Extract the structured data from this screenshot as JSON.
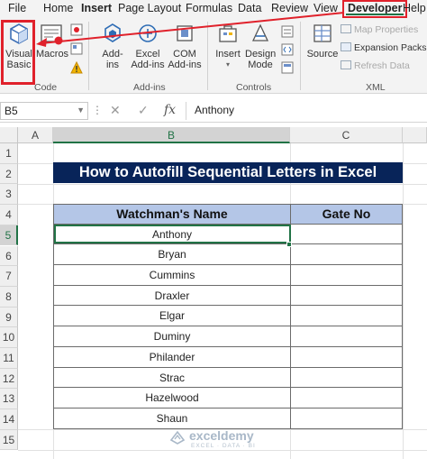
{
  "ribbon_tabs": [
    "File",
    "Home",
    "Insert",
    "Page Layout",
    "Formulas",
    "Data",
    "Review",
    "View",
    "Developer",
    "Help"
  ],
  "active_tab": "Developer",
  "ribbon": {
    "code": {
      "visual_basic_line1": "Visual",
      "visual_basic_line2": "Basic",
      "macros": "Macros",
      "group_label": "Code"
    },
    "addins": {
      "addins_line1": "Add-",
      "addins_line2": "ins",
      "excel_addins_line1": "Excel",
      "excel_addins_line2": "Add-ins",
      "com_addins_line1": "COM",
      "com_addins_line2": "Add-ins",
      "group_label": "Add-ins"
    },
    "controls": {
      "insert_line1": "Insert",
      "insert_line2": "",
      "design_mode_line1": "Design",
      "design_mode_line2": "Mode",
      "group_label": "Controls"
    },
    "xml": {
      "source": "Source",
      "map_properties": "Map Properties",
      "expansion_packs": "Expansion Packs",
      "refresh_data": "Refresh Data",
      "group_label": "XML"
    }
  },
  "formula_bar": {
    "name_box": "B5",
    "cancel": "✕",
    "enter": "✓",
    "fx": "fx",
    "content": "Anthony"
  },
  "columns": [
    "A",
    "B",
    "C"
  ],
  "rows": [
    "1",
    "2",
    "3",
    "4",
    "5",
    "6",
    "7",
    "8",
    "9",
    "10",
    "11",
    "12",
    "13",
    "14",
    "15"
  ],
  "active_cell": "B5",
  "sheet": {
    "title": "How to Autofill Sequential Letters in Excel",
    "headers": [
      "Watchman's Name",
      "Gate No"
    ],
    "names": [
      "Anthony",
      "Bryan",
      "Cummins",
      "Draxler",
      "Elgar",
      "Duminy",
      "Philander",
      "Strac",
      "Hazelwood",
      "Shaun"
    ]
  },
  "watermark": {
    "brand": "exceldemy",
    "tagline": "EXCEL · DATA · BI"
  },
  "colors": {
    "title_bg": "#082459",
    "header_bg": "#B4C6E7",
    "excel_green": "#217346",
    "highlight_red": "#E0212B"
  }
}
